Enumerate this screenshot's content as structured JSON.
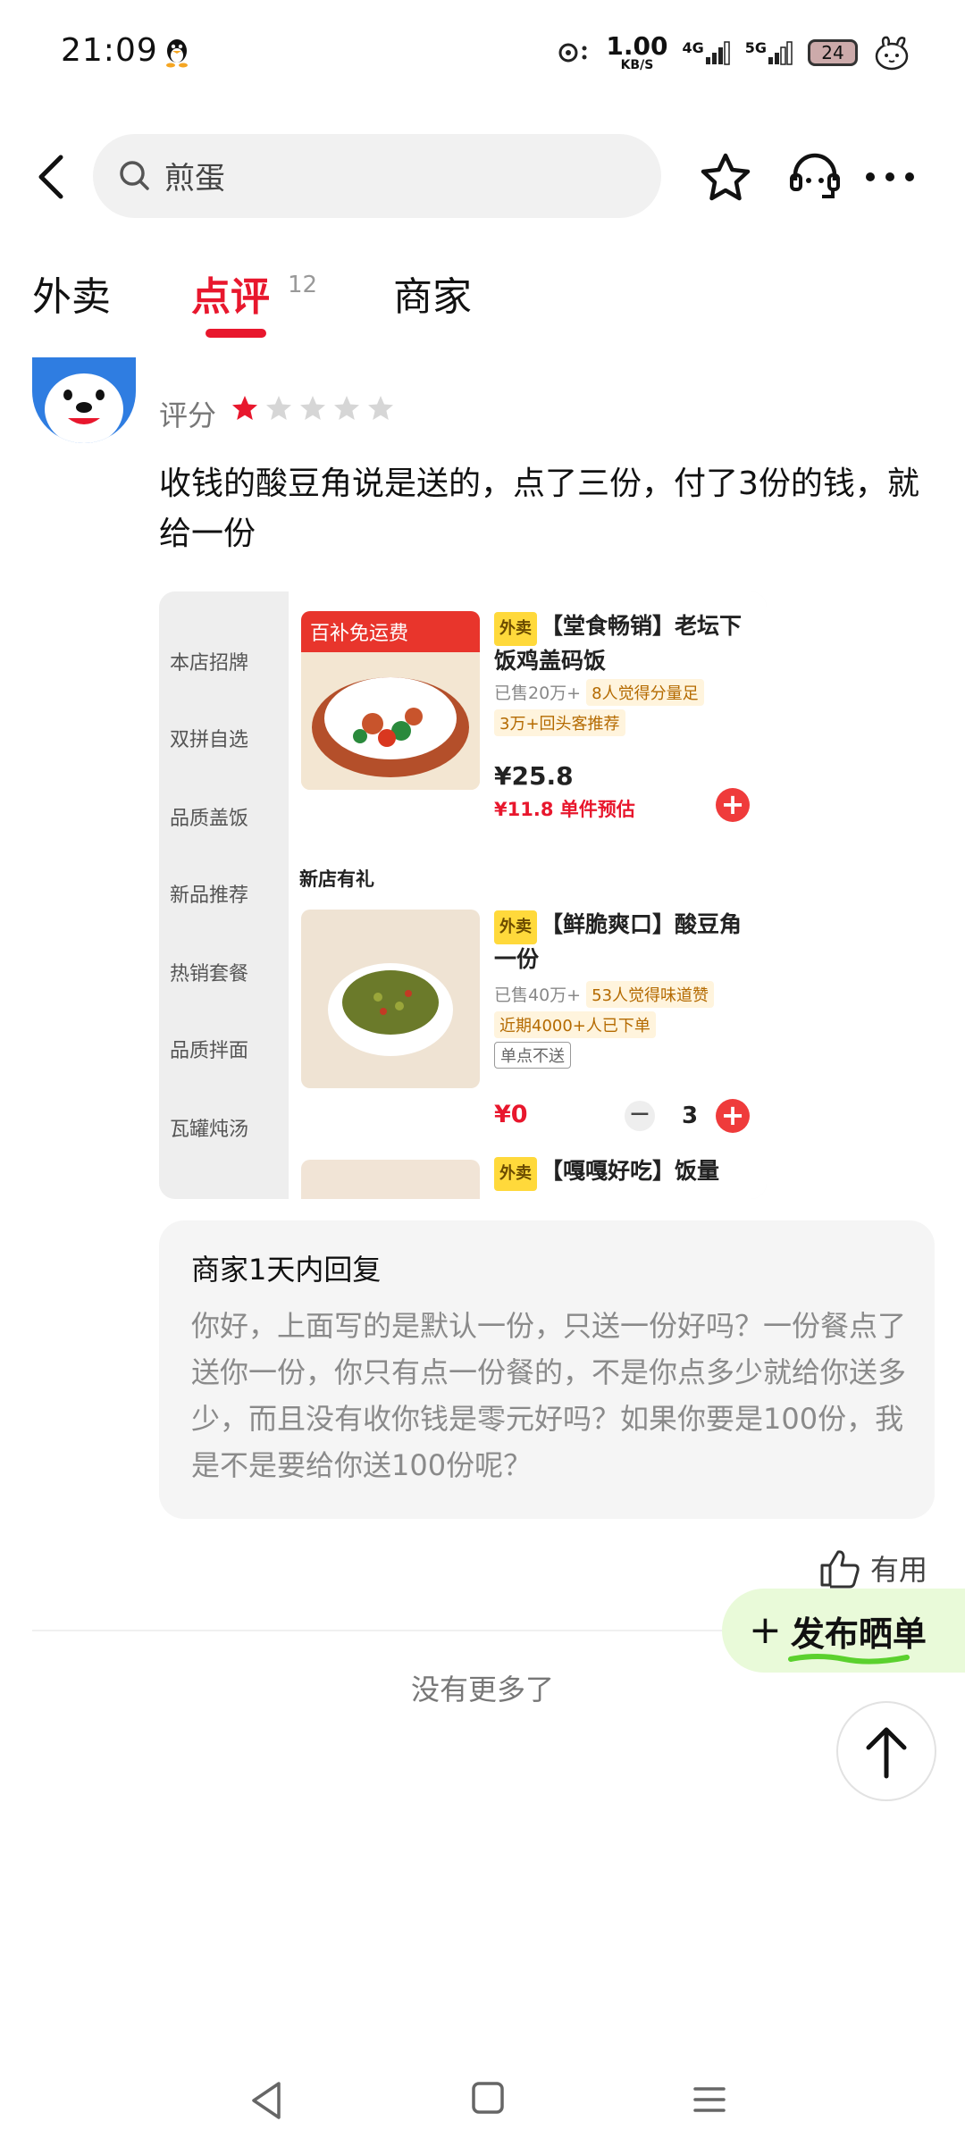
{
  "status_bar": {
    "time": "21:09",
    "net_speed_value": "1.00",
    "net_speed_unit": "KB/S",
    "signal_1": "4G",
    "signal_2": "5G",
    "battery": "24"
  },
  "header": {
    "search_text": "煎蛋"
  },
  "tabs": [
    {
      "label": "外卖",
      "active": false
    },
    {
      "label": "点评",
      "active": true,
      "count": "12"
    },
    {
      "label": "商家",
      "active": false
    }
  ],
  "review": {
    "rating_label": "评分",
    "rating": 1,
    "rating_max": 5,
    "text": "收钱的酸豆角说是送的，点了三份，付了3份的钱，就给一份",
    "photo": {
      "sidebar": [
        "本店招牌",
        "双拼自选",
        "品质盖饭",
        "新品推荐",
        "热销套餐",
        "品质拌面",
        "瓦罐炖汤"
      ],
      "banner_text": "百补免运费",
      "product1": {
        "tag": "外卖",
        "title": "【堂食畅销】老坛下饭鸡盖码饭",
        "sold": "已售20万+",
        "chip1": "8人觉得分量足",
        "chip2": "3万+回头客推荐",
        "price": "¥25.8",
        "price2": "¥11.8 单件预估"
      },
      "section": "新店有礼",
      "product2": {
        "tag": "外卖",
        "title": "【鲜脆爽口】酸豆角一份",
        "sold": "已售40万+",
        "chip1": "53人觉得味道赞",
        "chip2": "近期4000+人已下单",
        "chip3": "单点不送",
        "price": "¥0",
        "qty": "3"
      },
      "product3": {
        "tag": "外卖",
        "title": "【嘎嘎好吃】饭量"
      }
    }
  },
  "reply": {
    "title": "商家1天内回复",
    "text": "你好，上面写的是默认一份，只送一份好吗？一份餐点了送你一份，你只有点一份餐的，不是你点多少就给你送多少，而且没有收你钱是零元好吗？如果你要是100份，我是不是要给你送100份呢？"
  },
  "useful_label": "有用",
  "no_more": "没有更多了",
  "post_button": {
    "plus": "+",
    "label": "发布晒单"
  },
  "colors": {
    "accent": "#e8172d",
    "star_on": "#e8172d",
    "star_off": "#d6d6d6",
    "post_bg": "#e9fad9"
  }
}
